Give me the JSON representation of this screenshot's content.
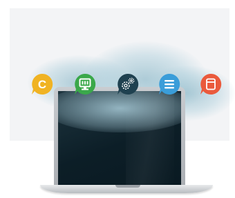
{
  "scene": {
    "colors": {
      "background": "#ffffff",
      "backdrop": "#f3f4f6",
      "laptop_frame": "#b9bdc1",
      "screen": "#0f232c"
    }
  },
  "app_icons": [
    {
      "name": "c-logo-icon",
      "color": "#f0b323",
      "glyph": "C"
    },
    {
      "name": "monitor-icon",
      "color": "#3aa84a"
    },
    {
      "name": "gears-icon",
      "color": "#1f4150"
    },
    {
      "name": "list-icon",
      "color": "#3a9dd9"
    },
    {
      "name": "archive-icon",
      "color": "#ea5a3c"
    }
  ]
}
